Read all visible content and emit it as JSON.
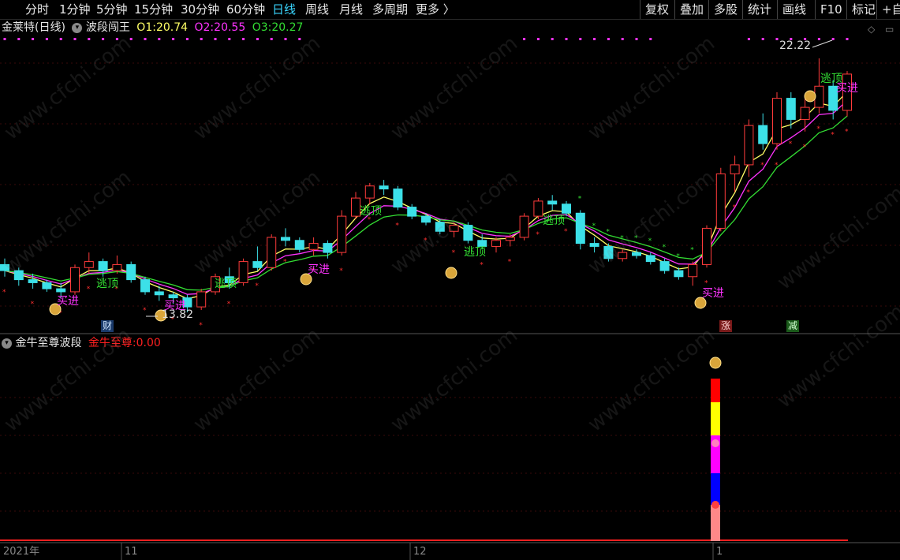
{
  "toolbar": {
    "periods": [
      "分时",
      "1分钟",
      "5分钟",
      "15分钟",
      "30分钟",
      "60分钟",
      "日线",
      "周线",
      "月线",
      "多周期",
      "更多 〉"
    ],
    "active_period": "日线",
    "right_items": [
      "复权",
      "叠加",
      "多股",
      "统计",
      "画线",
      "F10",
      "标记",
      "+自"
    ]
  },
  "main_panel": {
    "stock_name": "金莱特(日线)",
    "indicator_name": "波段闯王",
    "o1_label": "O1:",
    "o1_value": "20.74",
    "o2_label": "O2:",
    "o2_value": "20.55",
    "o3_label": "O3:",
    "o3_value": "20.27",
    "high_label": "22.22",
    "low_label": "13.82",
    "signals": {
      "buy": "买进",
      "sell": "逃顶"
    },
    "badges": [
      "财",
      "涨",
      "减"
    ]
  },
  "sub_panel": {
    "indicator_name": "金牛至尊波段",
    "value_label": "金牛至尊:",
    "value": "0.00"
  },
  "x_axis": {
    "labels": [
      "2021年",
      "11",
      "12",
      "1"
    ]
  },
  "watermark": "www.cfchi.com",
  "colors": {
    "up": "#ff3b3b",
    "down": "#3ce0e8",
    "o1": "#ffff66",
    "o2": "#ff33ff",
    "o3": "#33dd33",
    "accent": "#3ad6ff"
  },
  "chart_data": {
    "type": "candlestick",
    "ohlc": [
      [
        15.4,
        15.6,
        15.0,
        15.2
      ],
      [
        15.2,
        15.3,
        14.7,
        14.9
      ],
      [
        14.9,
        15.1,
        14.6,
        14.8
      ],
      [
        14.8,
        14.9,
        14.5,
        14.6
      ],
      [
        14.6,
        14.8,
        14.3,
        14.5
      ],
      [
        14.5,
        15.4,
        14.4,
        15.3
      ],
      [
        15.3,
        15.8,
        15.1,
        15.5
      ],
      [
        15.5,
        15.6,
        15.0,
        15.2
      ],
      [
        15.2,
        15.7,
        15.1,
        15.4
      ],
      [
        15.4,
        15.5,
        14.8,
        14.9
      ],
      [
        14.9,
        15.0,
        14.4,
        14.5
      ],
      [
        14.5,
        14.7,
        14.2,
        14.4
      ],
      [
        14.4,
        14.5,
        14.1,
        14.3
      ],
      [
        14.3,
        14.4,
        13.82,
        14.0
      ],
      [
        14.0,
        14.6,
        13.9,
        14.5
      ],
      [
        14.5,
        15.1,
        14.4,
        15.0
      ],
      [
        15.0,
        15.3,
        14.6,
        14.8
      ],
      [
        14.8,
        15.6,
        14.7,
        15.5
      ],
      [
        15.5,
        16.0,
        15.2,
        15.3
      ],
      [
        15.3,
        16.4,
        15.2,
        16.3
      ],
      [
        16.3,
        16.6,
        16.0,
        16.2
      ],
      [
        16.2,
        16.3,
        15.8,
        15.9
      ],
      [
        15.9,
        16.3,
        15.7,
        16.1
      ],
      [
        16.1,
        16.2,
        15.6,
        15.8
      ],
      [
        15.8,
        17.2,
        15.7,
        17.0
      ],
      [
        17.0,
        17.8,
        16.9,
        17.6
      ],
      [
        17.6,
        18.1,
        17.4,
        18.0
      ],
      [
        18.0,
        18.2,
        17.7,
        17.9
      ],
      [
        17.9,
        18.0,
        17.2,
        17.3
      ],
      [
        17.3,
        17.4,
        16.9,
        17.0
      ],
      [
        17.0,
        17.1,
        16.7,
        16.8
      ],
      [
        16.8,
        16.9,
        16.4,
        16.5
      ],
      [
        16.5,
        16.8,
        16.3,
        16.7
      ],
      [
        16.7,
        16.8,
        16.1,
        16.2
      ],
      [
        16.2,
        16.4,
        15.9,
        16.0
      ],
      [
        16.0,
        16.3,
        15.8,
        16.2
      ],
      [
        16.2,
        16.4,
        16.0,
        16.3
      ],
      [
        16.3,
        17.1,
        16.2,
        17.0
      ],
      [
        17.0,
        17.6,
        16.9,
        17.5
      ],
      [
        17.5,
        17.7,
        17.2,
        17.4
      ],
      [
        17.4,
        17.5,
        17.0,
        17.1
      ],
      [
        17.1,
        17.2,
        15.9,
        16.1
      ],
      [
        16.1,
        16.3,
        15.8,
        16.0
      ],
      [
        16.0,
        16.1,
        15.5,
        15.6
      ],
      [
        15.6,
        15.9,
        15.5,
        15.8
      ],
      [
        15.8,
        15.9,
        15.6,
        15.7
      ],
      [
        15.7,
        15.8,
        15.4,
        15.5
      ],
      [
        15.5,
        15.6,
        15.1,
        15.2
      ],
      [
        15.2,
        15.3,
        14.9,
        15.0
      ],
      [
        15.0,
        15.5,
        14.7,
        15.4
      ],
      [
        15.4,
        16.7,
        15.3,
        16.6
      ],
      [
        16.6,
        18.6,
        16.5,
        18.4
      ],
      [
        18.4,
        19.0,
        17.8,
        18.7
      ],
      [
        18.7,
        20.2,
        18.3,
        20.0
      ],
      [
        20.0,
        20.4,
        19.2,
        19.4
      ],
      [
        19.4,
        21.1,
        19.2,
        20.9
      ],
      [
        20.9,
        21.1,
        19.9,
        20.2
      ],
      [
        20.2,
        21.0,
        19.8,
        20.6
      ],
      [
        20.6,
        22.22,
        20.4,
        21.3
      ],
      [
        21.3,
        21.5,
        20.2,
        20.5
      ],
      [
        20.5,
        21.8,
        20.3,
        21.7
      ]
    ],
    "series": [
      {
        "name": "O1",
        "last": 20.74
      },
      {
        "name": "O2",
        "last": 20.55
      },
      {
        "name": "O3",
        "last": 20.27
      }
    ],
    "max": 22.22,
    "min": 13.82
  }
}
